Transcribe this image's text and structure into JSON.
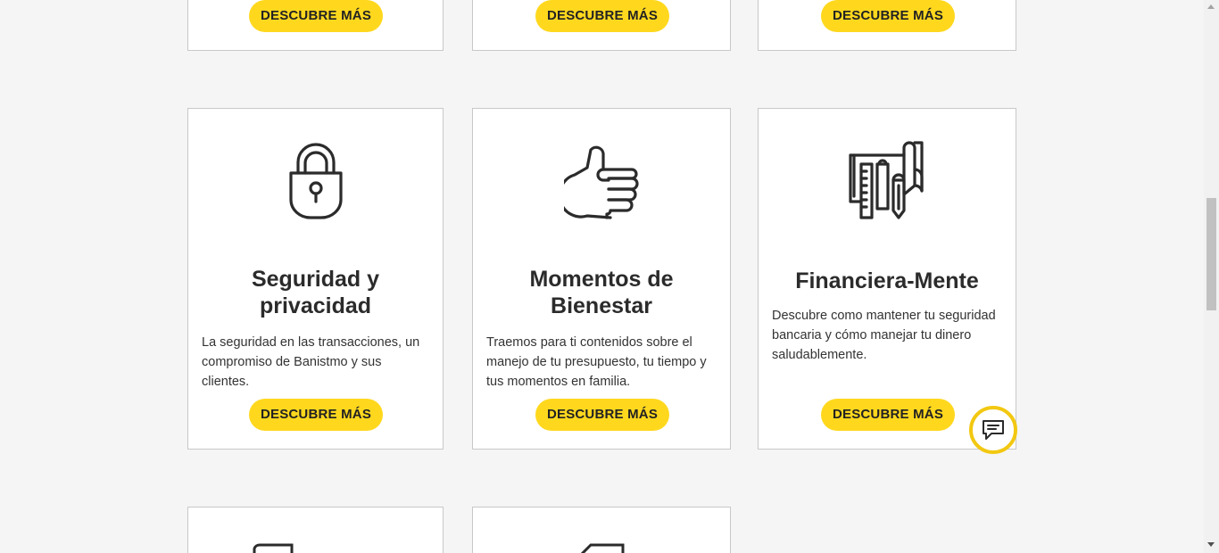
{
  "colors": {
    "accent": "#ffd81e",
    "chat_ring": "#f2c811",
    "background": "#f5f5f5",
    "card_border": "#c8c8c8",
    "text": "#2b2b2b"
  },
  "top_row": {
    "cards": [
      {
        "button_label": "DESCUBRE MÁS"
      },
      {
        "button_label": "DESCUBRE MÁS"
      },
      {
        "button_label": "DESCUBRE MÁS"
      }
    ]
  },
  "middle_row": {
    "cards": [
      {
        "icon": "padlock-icon",
        "title": "Seguridad y privacidad",
        "description": "La seguridad en las transacciones, un compromiso de Banistmo y sus clientes.",
        "button_label": "DESCUBRE MÁS"
      },
      {
        "icon": "thumbs-up-icon",
        "title": "Momentos de Bienestar",
        "description": "Traemos para ti contenidos sobre el manejo de tu presupuesto, tu tiempo y tus momentos en familia.",
        "button_label": "DESCUBRE MÁS"
      },
      {
        "icon": "blueprint-tools-icon",
        "title": "Financiera-Mente",
        "description": "Descubre como mantener tu seguridad bancaria y cómo manejar tu dinero saludablemente.",
        "button_label": "DESCUBRE MÁS"
      }
    ]
  },
  "chat": {
    "icon": "chat-bubble-icon"
  }
}
